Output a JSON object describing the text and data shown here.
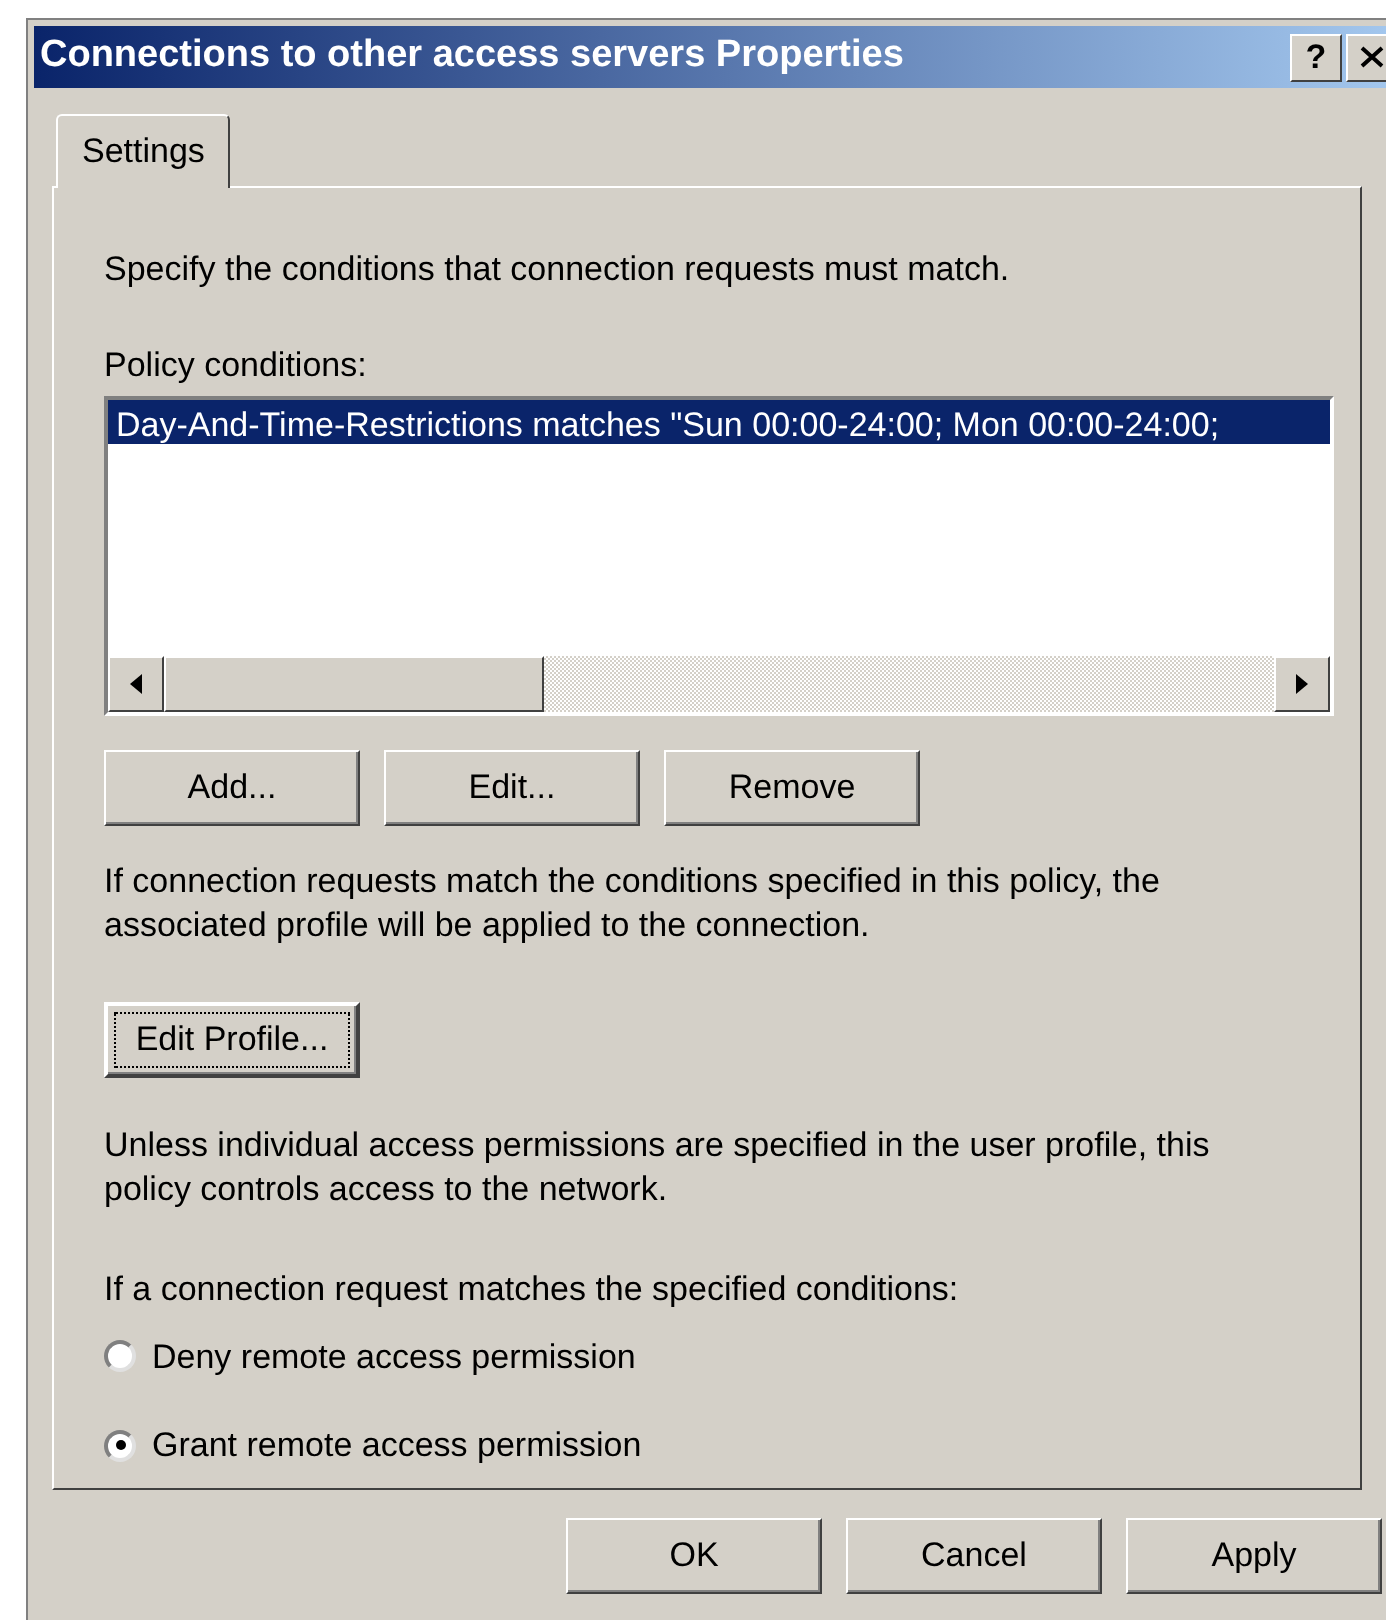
{
  "window": {
    "title": "Connections to other access servers Properties",
    "help_button": "?"
  },
  "tabs": [
    {
      "label": "Settings",
      "selected": true
    }
  ],
  "intro": "Specify the conditions that connection requests must match.",
  "conditions": {
    "label": "Policy conditions:",
    "items": [
      {
        "text": "Day-And-Time-Restrictions matches \"Sun 00:00-24:00; Mon 00:00-24:00;",
        "selected": true
      }
    ]
  },
  "condition_buttons": [
    "Add...",
    "Edit...",
    "Remove"
  ],
  "profile_note": "If connection requests match the conditions specified in this policy, the associated profile will be applied to the connection.",
  "profile_button": "Edit Profile...",
  "access_note": "Unless individual access permissions are specified in the user profile, this policy controls access to the network.",
  "permission": {
    "label": "If a connection request matches the specified conditions:",
    "options": [
      {
        "label": "Deny remote access permission",
        "selected": false
      },
      {
        "label": "Grant remote access permission",
        "selected": true
      }
    ]
  },
  "buttons": [
    "OK",
    "Cancel",
    "Apply"
  ]
}
